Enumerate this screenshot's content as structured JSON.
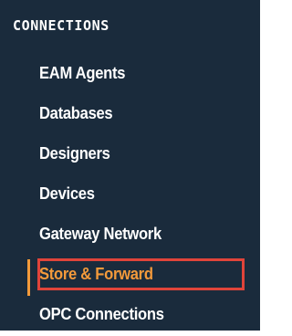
{
  "sidebar": {
    "section_title": "CONNECTIONS",
    "items": [
      {
        "label": "EAM Agents",
        "active": false
      },
      {
        "label": "Databases",
        "active": false
      },
      {
        "label": "Designers",
        "active": false
      },
      {
        "label": "Devices",
        "active": false
      },
      {
        "label": "Gateway Network",
        "active": false
      },
      {
        "label": "Store & Forward",
        "active": true
      },
      {
        "label": "OPC Connections",
        "active": false
      }
    ]
  },
  "colors": {
    "sidebar_background": "#1a2b3c",
    "text": "#ffffff",
    "active_accent": "#f39a3b",
    "highlight_outline": "#e0443a"
  }
}
